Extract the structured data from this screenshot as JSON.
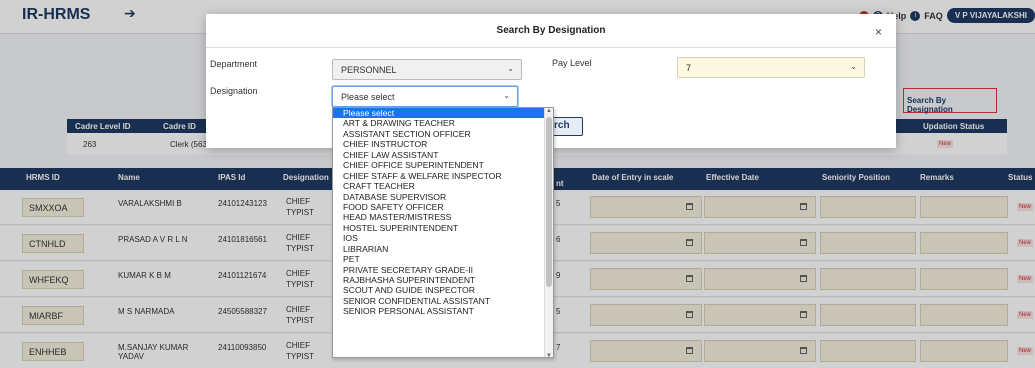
{
  "app": {
    "title": "IR-HRMS",
    "menu_icon": "arrow-right-icon"
  },
  "header": {
    "help": "Help",
    "faq": "FAQ",
    "user": "V P VIJAYALAKSHI"
  },
  "search_by_designation_link": "Search By Designation",
  "cadre_table": {
    "headers": [
      "Cadre Level ID",
      "Cadre ID",
      "Updation Status"
    ],
    "row": {
      "cadre_level_id": "263",
      "cadre": "Clerk (563",
      "status": "New"
    }
  },
  "main_table": {
    "headers": [
      "HRMS ID",
      "Name",
      "IPAS Id",
      "Designation",
      "nt",
      "Date of Entry in scale",
      "Effective Date",
      "Seniority Position",
      "Remarks",
      "Status"
    ],
    "rows": [
      {
        "hrms": "SMXXOA",
        "name": "VARALAKSHMI B",
        "ipas": "24101243123",
        "desg": "CHIEF TYPIST",
        "num": "5",
        "status": "New"
      },
      {
        "hrms": "CTNHLD",
        "name": "PRASAD A V R L N",
        "ipas": "24101816561",
        "desg": "CHIEF TYPIST",
        "num": "6",
        "status": "New"
      },
      {
        "hrms": "WHFEKQ",
        "name": "KUMAR K B M",
        "ipas": "24101121674",
        "desg": "CHIEF TYPIST",
        "num": "9",
        "status": "New"
      },
      {
        "hrms": "MIARBF",
        "name": "M S NARMADA",
        "ipas": "24505588327",
        "desg": "CHIEF TYPIST",
        "num": "5",
        "status": "New"
      },
      {
        "hrms": "ENHHEB",
        "name": "M.SANJAY KUMAR YADAV",
        "ipas": "24110093850",
        "desg": "CHIEF TYPIST",
        "num": "7",
        "status": "New"
      }
    ]
  },
  "modal": {
    "title": "Search By Designation",
    "close": "×",
    "department_label": "Department",
    "department_value": "PERSONNEL",
    "pay_level_label": "Pay Level",
    "pay_level_value": "7",
    "designation_label": "Designation",
    "designation_value": "Please select",
    "search_button": "rch"
  },
  "designation_options": [
    "Please select",
    "ART & DRAWING TEACHER",
    "ASSISTANT SECTION OFFICER",
    "CHIEF INSTRUCTOR",
    "CHIEF LAW ASSISTANT",
    "CHIEF OFFICE SUPERINTENDENT",
    "CHIEF STAFF & WELFARE INSPECTOR",
    "CRAFT TEACHER",
    "DATABASE SUPERVISOR",
    "FOOD SAFETY OFFICER",
    "HEAD MASTER/MISTRESS",
    "HOSTEL SUPERINTENDENT",
    "IOS",
    "LIBRARIAN",
    "PET",
    "PRIVATE SECRETARY GRADE-II",
    "RAJBHASHA SUPERINTENDENT",
    "SCOUT AND GUIDE INSPECTOR",
    "SENIOR CONFIDENTIAL ASSISTANT",
    "SENIOR PERSONAL ASSISTANT"
  ]
}
